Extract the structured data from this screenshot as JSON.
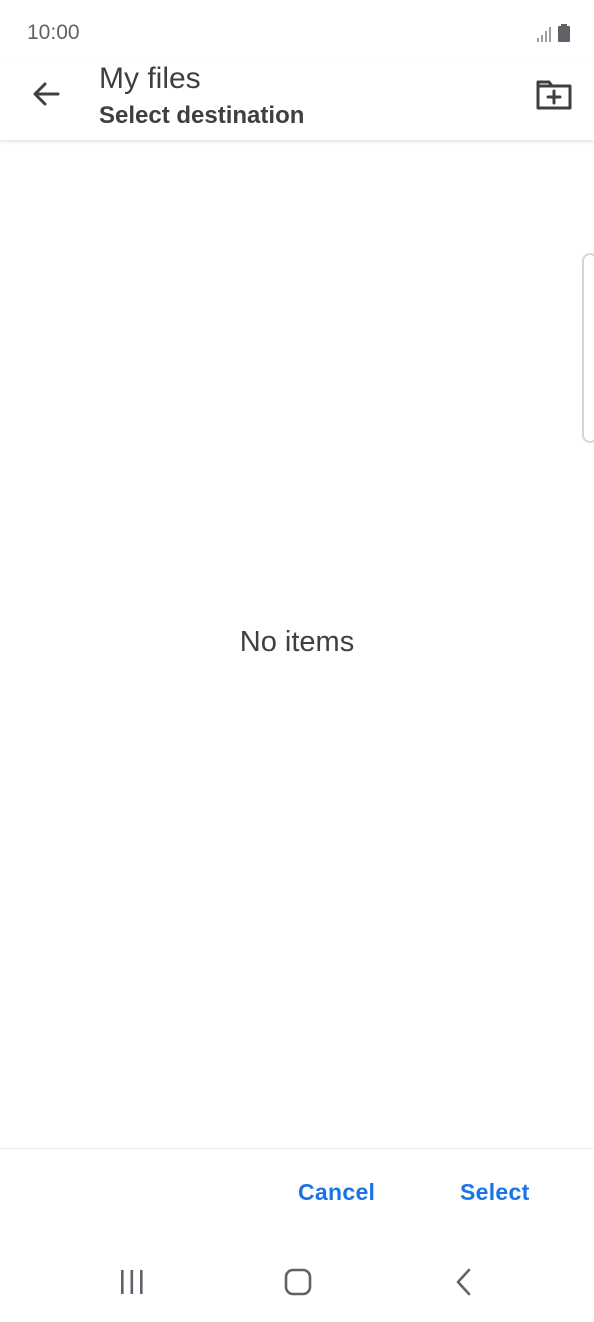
{
  "status_bar": {
    "time": "10:00",
    "icons": [
      "signal-icon",
      "battery-icon"
    ]
  },
  "header": {
    "title": "My files",
    "subtitle": "Select destination",
    "back_icon": "arrow-back-icon",
    "new_folder_icon": "create-folder-icon"
  },
  "content": {
    "empty_message": "No items"
  },
  "actions": {
    "cancel_label": "Cancel",
    "select_label": "Select",
    "accent_color": "#1a73e8"
  },
  "navigation": {
    "recents_icon": "recents-icon",
    "home_icon": "home-icon",
    "back_icon": "nav-back-icon"
  }
}
